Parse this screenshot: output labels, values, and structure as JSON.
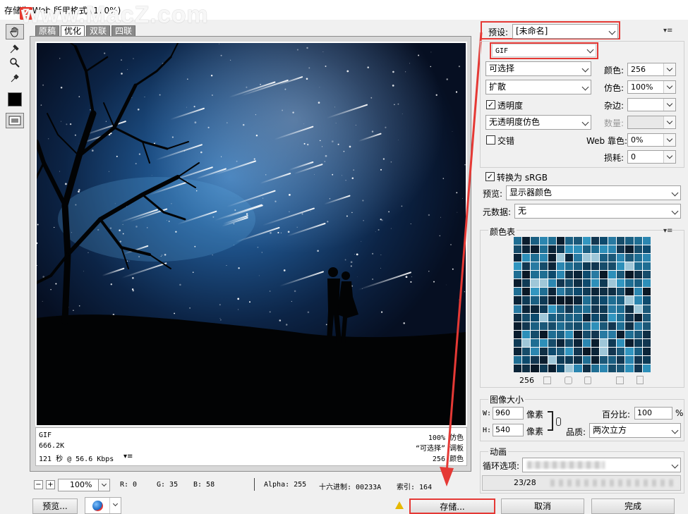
{
  "window": {
    "title": "存储为 Web 所用格式 (100%)",
    "watermark": "www.MacZ.com",
    "logo": "Z"
  },
  "tools": [
    "hand-tool-icon",
    "slice-select-icon",
    "zoom-icon",
    "eyedropper-icon",
    "color-swatch",
    "toggle-slices-icon"
  ],
  "tabs": [
    {
      "label": "原稿",
      "active": false
    },
    {
      "label": "优化",
      "active": true
    },
    {
      "label": "双联",
      "active": false
    },
    {
      "label": "四联",
      "active": false
    }
  ],
  "info": {
    "format": "GIF",
    "size": "666.2K",
    "time": "121 秒 @ 56.6 Kbps",
    "dither": "100% 仿色",
    "palette": "“可选择” 调板",
    "colors": "256 颜色"
  },
  "status": {
    "zoom": "100%",
    "r": "R: 0",
    "g": "G: 35",
    "b": "B: 58",
    "alpha": "Alpha: 255",
    "hex": "十六进制: 00233A",
    "index": "索引: 164"
  },
  "buttons": {
    "preview": "预览...",
    "save": "存储...",
    "cancel": "取消",
    "done": "完成"
  },
  "settings": {
    "preset_label": "预设:",
    "preset_value": "[未命名]",
    "format_value": "GIF",
    "reduction": "可选择",
    "dither_algo": "扩散",
    "transparency_label": "透明度",
    "transparency_checked": true,
    "transparency_dither": "无透明度仿色",
    "interlaced_label": "交错",
    "interlaced_checked": false,
    "colors_label": "颜色:",
    "colors_value": "256",
    "dither_label": "仿色:",
    "dither_value": "100%",
    "matte_label": "杂边:",
    "matte_value": "",
    "amount_label": "数量:",
    "amount_value": "",
    "websnap_label": "Web 靠色:",
    "websnap_value": "0%",
    "lossy_label": "损耗:",
    "lossy_value": "0",
    "srgb_label": "转换为 sRGB",
    "srgb_checked": true,
    "preview_label": "预览:",
    "preview_value": "显示器颜色",
    "metadata_label": "元数据:",
    "metadata_value": "无"
  },
  "color_table": {
    "title": "颜色表",
    "count": "256",
    "colors": [
      "#0e3a55",
      "#1a5f82",
      "#0b2438",
      "#2b86b0",
      "#0d4a6d",
      "#9fc7d8",
      "#123650",
      "#1f6e93",
      "#0a1d2e",
      "#3296c0",
      "#164c6a",
      "#0f2f45",
      "#287aa2",
      "#091826",
      "#1b5878",
      "#2d8fb9"
    ]
  },
  "image_size": {
    "title": "图像大小",
    "w_label": "W:",
    "w_value": "960",
    "h_label": "H:",
    "h_value": "540",
    "unit": "像素",
    "percent_label": "百分比:",
    "percent_value": "100",
    "percent_unit": "%",
    "quality_label": "品质:",
    "quality_value": "两次立方"
  },
  "animation": {
    "title": "动画",
    "loop_label": "循环选项:",
    "frame": "23/28"
  }
}
